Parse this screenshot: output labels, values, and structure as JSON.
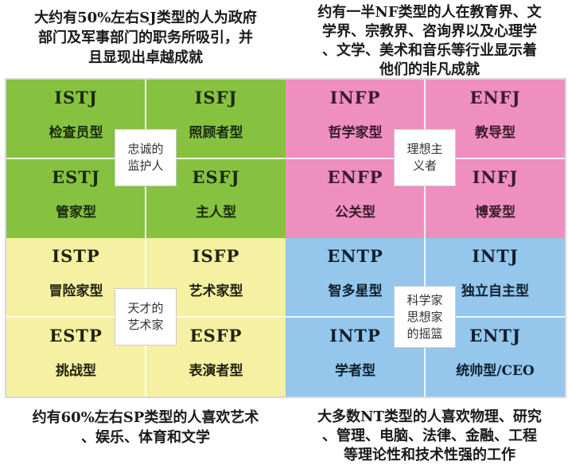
{
  "notes": {
    "sj": "大约有50%左右SJ类型的人为政府\n部门及军事部门的职务所吸引，并\n且显现出卓越成就",
    "nf": "约有一半NF类型的人在教育界、文\n学界、宗教界、咨询界以及心理学\n、文学、美术和音乐等行业显示着\n他们的非凡成就",
    "sp": "约有60%左右SP类型的人喜欢艺术\n、娱乐、体育和文学",
    "nt": "大多数NT类型的人喜欢物理、研究\n、管理、电脑、法律、金融、工程\n等理论性和技术性强的工作"
  },
  "quadrants": {
    "sj": {
      "color": "#86c240",
      "center_label": "忠诚的\n监护人",
      "cells": [
        {
          "code": "ISTJ",
          "role": "检查员型"
        },
        {
          "code": "ISFJ",
          "role": "照顾者型"
        },
        {
          "code": "ESTJ",
          "role": "管家型"
        },
        {
          "code": "ESFJ",
          "role": "主人型"
        }
      ]
    },
    "nf": {
      "color": "#ef8fc0",
      "center_label": "理想主\n义者",
      "cells": [
        {
          "code": "INFP",
          "role": "哲学家型"
        },
        {
          "code": "ENFJ",
          "role": "教导型"
        },
        {
          "code": "ENFP",
          "role": "公关型"
        },
        {
          "code": "INFJ",
          "role": "博爱型"
        }
      ]
    },
    "sp": {
      "color": "#f5f0a2",
      "center_label": "天才的\n艺术家",
      "cells": [
        {
          "code": "ISTP",
          "role": "冒险家型"
        },
        {
          "code": "ISFP",
          "role": "艺术家型"
        },
        {
          "code": "ESTP",
          "role": "挑战型"
        },
        {
          "code": "ESFP",
          "role": "表演者型"
        }
      ]
    },
    "nt": {
      "color": "#95c6ec",
      "center_label": "科学家\n思想家\n的摇篮",
      "cells": [
        {
          "code": "ENTP",
          "role": "智多星型"
        },
        {
          "code": "INTJ",
          "role": "独立自主型"
        },
        {
          "code": "INTP",
          "role": "学者型"
        },
        {
          "code": "ENTJ",
          "role": "统帅型/CEO"
        }
      ]
    }
  }
}
